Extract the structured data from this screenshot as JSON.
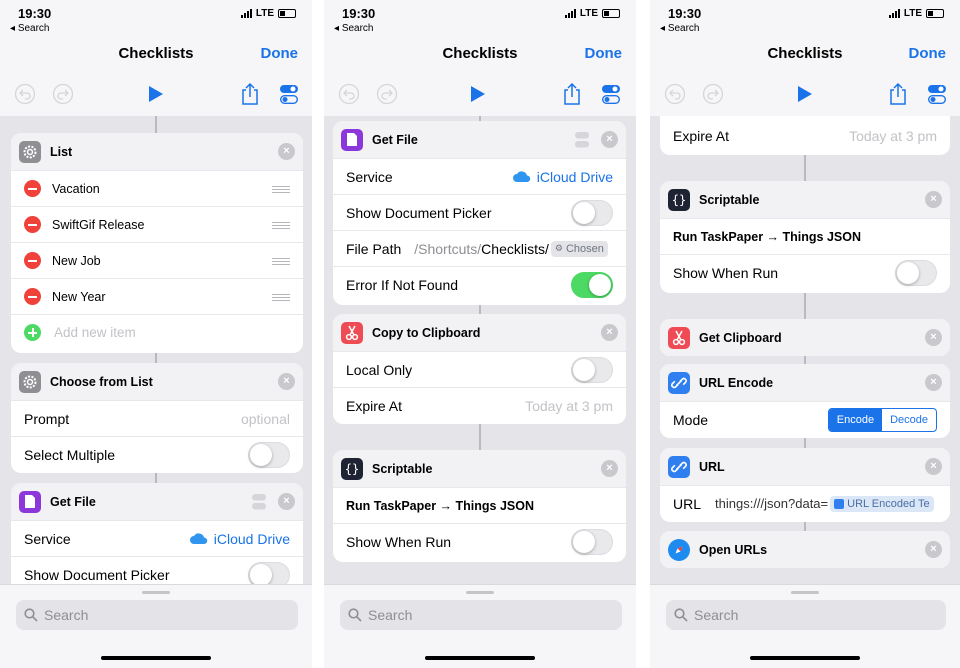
{
  "status": {
    "time": "19:30",
    "back": "Search",
    "network": "LTE"
  },
  "nav": {
    "title": "Checklists",
    "done": "Done"
  },
  "search": {
    "placeholder": "Search"
  },
  "screen1": {
    "list": {
      "title": "List",
      "items": [
        "Vacation",
        "SwiftGif Release",
        "New Job",
        "New Year"
      ],
      "add_placeholder": "Add new item"
    },
    "choose": {
      "title": "Choose from List",
      "prompt_label": "Prompt",
      "prompt_placeholder": "optional",
      "select_multiple": "Select Multiple"
    },
    "getfile": {
      "title": "Get File",
      "service_label": "Service",
      "service_value": "iCloud Drive",
      "picker_label": "Show Document Picker"
    }
  },
  "screen2": {
    "getfile": {
      "title": "Get File",
      "service_label": "Service",
      "service_value": "iCloud Drive",
      "picker_label": "Show Document Picker",
      "path_label": "File Path",
      "path_prefix": "/Shortcuts/",
      "path_folder": "Checklists/",
      "path_token": "Chosen",
      "error_label": "Error If Not Found"
    },
    "clipboard": {
      "title": "Copy to Clipboard",
      "local_label": "Local Only",
      "expire_label": "Expire At",
      "expire_value": "Today at 3 pm"
    },
    "scriptable": {
      "title": "Scriptable",
      "script": "Run TaskPaper → Things JSON",
      "show_label": "Show When Run"
    }
  },
  "screen3": {
    "expire": {
      "label": "Expire At",
      "value": "Today at 3 pm"
    },
    "scriptable": {
      "title": "Scriptable",
      "script": "Run TaskPaper → Things JSON",
      "show_label": "Show When Run"
    },
    "getclip": {
      "title": "Get Clipboard"
    },
    "encode": {
      "title": "URL Encode",
      "mode_label": "Mode",
      "mode_options": [
        "Encode",
        "Decode"
      ]
    },
    "url": {
      "title": "URL",
      "label": "URL",
      "value": "things:///json?data=",
      "token": "URL Encoded Te"
    },
    "open": {
      "title": "Open URLs"
    }
  },
  "colors": {
    "accent": "#1a73e8",
    "toggle_on": "#4cd964",
    "delete": "#f0423a",
    "files": "#8c37d9",
    "clipboard": "#ef4b55",
    "scriptable": "#1e2433",
    "url": "#2f7ff0",
    "safari": "#1e8bf0"
  },
  "icons": [
    "gear-icon",
    "file-icon",
    "scissors-icon",
    "braces-icon",
    "link-icon",
    "compass-icon",
    "undo-icon",
    "redo-icon",
    "play-icon",
    "share-icon",
    "settings-toggle-icon",
    "magnifier-icon",
    "cloud-icon"
  ]
}
